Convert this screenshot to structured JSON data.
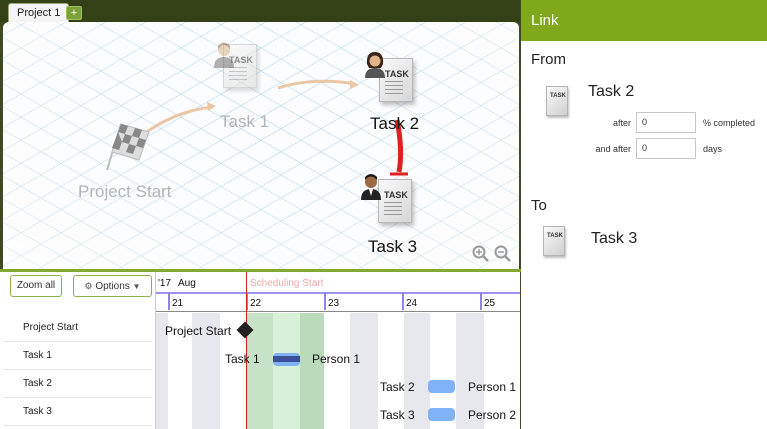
{
  "tabs": {
    "active_label": "Project 1",
    "add_label": "+"
  },
  "canvas": {
    "nodes": {
      "project_start": "Project Start",
      "task1": "Task 1",
      "task2": "Task 2",
      "task3": "Task 3"
    },
    "doc_title": "TASK"
  },
  "gantt": {
    "zoom_all_label": "Zoom all",
    "options_label": "Options",
    "year_label": "'17",
    "month_label": "Aug",
    "scheduling_start_label": "Scheduling Start",
    "days": [
      "21",
      "22",
      "23",
      "24",
      "25"
    ],
    "rows": [
      "Project Start",
      "Task 1",
      "Task 2",
      "Task 3"
    ],
    "chart_items": {
      "project_start": "Project Start",
      "task1": "Task 1",
      "task1_resource": "Person 1",
      "task2": "Task 2",
      "task2_resource": "Person 1",
      "task3": "Task 3",
      "task3_resource": "Person 2"
    }
  },
  "link_panel": {
    "title": "Link",
    "from_label": "From",
    "from_task": "Task 2",
    "after_label": "after",
    "after_value": "0",
    "after_unit": "% completed",
    "and_after_label": "and after",
    "and_after_value": "0",
    "and_after_unit": "days",
    "to_label": "To",
    "to_task": "Task 3",
    "doc_title": "TASK"
  },
  "colors": {
    "accent": "#7fa81a",
    "link_arrow": "#e02020",
    "task_bar_dark": "#3a4f9a",
    "task_bar_light": "#7fb3f5",
    "today_line": "#cc2222"
  }
}
